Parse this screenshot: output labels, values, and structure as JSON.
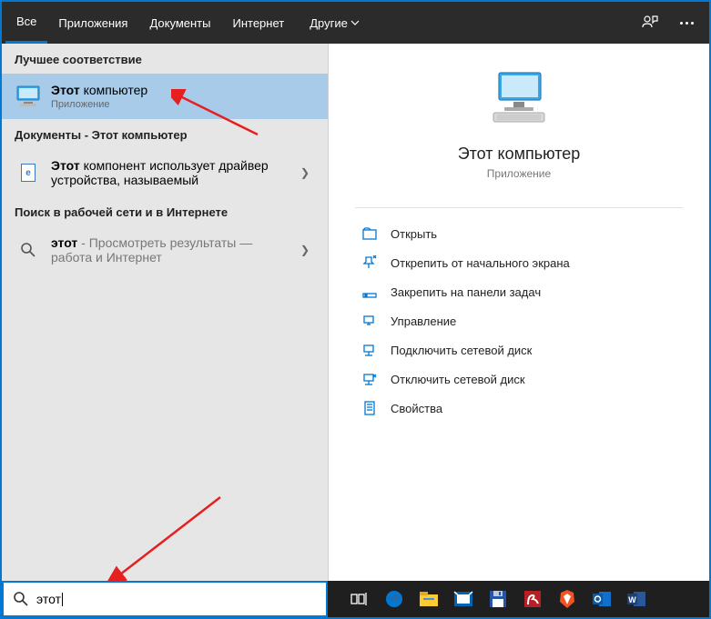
{
  "tabs": {
    "all": "Все",
    "apps": "Приложения",
    "docs": "Документы",
    "web": "Интернет",
    "more": "Другие"
  },
  "left": {
    "best_match": "Лучшее соответствие",
    "result1": {
      "bold": "Этот",
      "rest": " компьютер",
      "sub": "Приложение"
    },
    "docs_header": "Документы - Этот компьютер",
    "result2": {
      "bold": "Этот",
      "rest": " компонент использует драйвер устройства, называемый"
    },
    "web_header": "Поиск в рабочей сети и в Интернете",
    "result3": {
      "bold": "этот",
      "rest": " - Просмотреть результаты — работа и Интернет"
    }
  },
  "preview": {
    "title": "Этот компьютер",
    "sub": "Приложение"
  },
  "actions": {
    "open": "Открыть",
    "unpin": "Открепить от начального экрана",
    "pin_taskbar": "Закрепить на панели задач",
    "manage": "Управление",
    "map_drive": "Подключить сетевой диск",
    "disconnect_drive": "Отключить сетевой диск",
    "properties": "Свойства"
  },
  "search": {
    "value": "этот"
  }
}
